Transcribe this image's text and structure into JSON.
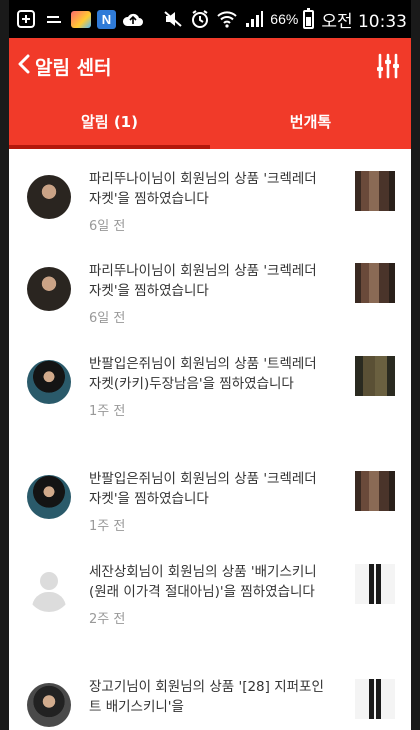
{
  "status_bar": {
    "icons": [
      "plus-box-icon",
      "gallery-icon",
      "n-app-icon",
      "upload-cloud-icon",
      "mute-icon",
      "alarm-icon",
      "wifi-icon",
      "signal-icon",
      "battery-icon"
    ],
    "n_badge": "N",
    "battery_text": "66%",
    "time": "오전 10:33"
  },
  "header": {
    "title": "알림 센터",
    "back_icon": "chevron-left-icon",
    "filter_icon": "sliders-icon"
  },
  "tabs": [
    {
      "label": "알림 (1)",
      "active": true
    },
    {
      "label": "번개톡",
      "active": false
    }
  ],
  "notifications": [
    {
      "message": "파리뚜나이님이 회원님의 상품 '크렉레더자켓'을 찜하였습니다",
      "time": "6일 전"
    },
    {
      "message": "파리뚜나이님이 회원님의 상품 '크렉레더자켓'을 찜하였습니다",
      "time": "6일 전"
    },
    {
      "message": "반팔입은쥐님이 회원님의 상품 '트렉레더자켓(카키)두장남음'을 찜하였습니다",
      "time": "1주 전"
    },
    {
      "message": "반팔입은쥐님이 회원님의 상품 '크렉레더자켓'을 찜하였습니다",
      "time": "1주 전"
    },
    {
      "message": "세잔상회님이 회원님의 상품 '배기스키니(원래 이가격 절대아님)'을 찜하였습니다",
      "time": "2주 전"
    },
    {
      "message": "장고기님이 회원님의 상품 '[28] 지퍼포인트 배기스키니'을",
      "time": ""
    }
  ],
  "colors": {
    "accent": "#f13a29",
    "tab_indicator": "#b3180b",
    "message_text": "#333333",
    "time_text": "#999999"
  }
}
